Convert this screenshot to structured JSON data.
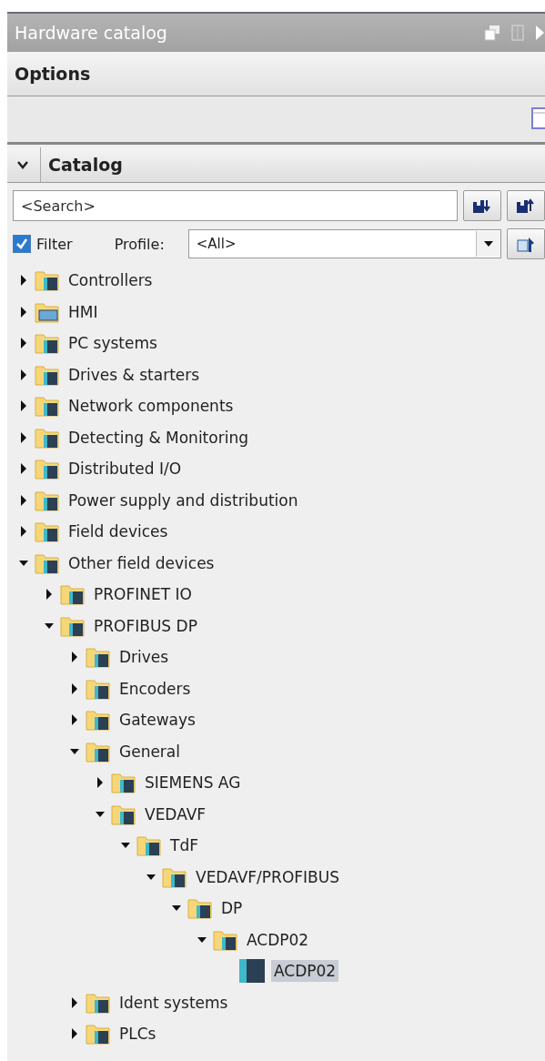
{
  "window": {
    "title": "Hardware catalog"
  },
  "options": {
    "title": "Options"
  },
  "catalog": {
    "title": "Catalog",
    "expanded": true
  },
  "search": {
    "placeholder": "<Search>"
  },
  "filter": {
    "label": "Filter",
    "checked": true
  },
  "profile": {
    "label": "Profile:",
    "value": "<All>"
  },
  "tree": [
    {
      "label": "Controllers",
      "kind": "folder",
      "expanded": false,
      "selected": false
    },
    {
      "label": "HMI",
      "kind": "hmi-folder",
      "expanded": false,
      "selected": false
    },
    {
      "label": "PC systems",
      "kind": "folder",
      "expanded": false,
      "selected": false
    },
    {
      "label": "Drives & starters",
      "kind": "folder",
      "expanded": false,
      "selected": false
    },
    {
      "label": "Network components",
      "kind": "folder",
      "expanded": false,
      "selected": false
    },
    {
      "label": "Detecting & Monitoring",
      "kind": "folder",
      "expanded": false,
      "selected": false
    },
    {
      "label": "Distributed I/O",
      "kind": "folder",
      "expanded": false,
      "selected": false
    },
    {
      "label": "Power supply and distribution",
      "kind": "folder",
      "expanded": false,
      "selected": false
    },
    {
      "label": "Field devices",
      "kind": "folder",
      "expanded": false,
      "selected": false
    },
    {
      "label": "Other field devices",
      "kind": "folder",
      "expanded": true,
      "selected": false,
      "children": [
        {
          "label": "PROFINET IO",
          "kind": "folder",
          "expanded": false,
          "selected": false
        },
        {
          "label": "PROFIBUS DP",
          "kind": "folder",
          "expanded": true,
          "selected": false,
          "children": [
            {
              "label": "Drives",
              "kind": "folder",
              "expanded": false,
              "selected": false
            },
            {
              "label": "Encoders",
              "kind": "folder",
              "expanded": false,
              "selected": false
            },
            {
              "label": "Gateways",
              "kind": "folder",
              "expanded": false,
              "selected": false
            },
            {
              "label": "General",
              "kind": "folder",
              "expanded": true,
              "selected": false,
              "children": [
                {
                  "label": "SIEMENS AG",
                  "kind": "folder",
                  "expanded": false,
                  "selected": false
                },
                {
                  "label": "VEDAVF",
                  "kind": "folder",
                  "expanded": true,
                  "selected": false,
                  "children": [
                    {
                      "label": "TdF",
                      "kind": "folder",
                      "expanded": true,
                      "selected": false,
                      "children": [
                        {
                          "label": "VEDAVF/PROFIBUS",
                          "kind": "folder",
                          "expanded": true,
                          "selected": false,
                          "children": [
                            {
                              "label": "DP",
                              "kind": "folder",
                              "expanded": true,
                              "selected": false,
                              "children": [
                                {
                                  "label": "ACDP02",
                                  "kind": "folder",
                                  "expanded": true,
                                  "selected": false,
                                  "children": [
                                    {
                                      "label": "ACDP02",
                                      "kind": "device",
                                      "selected": true
                                    }
                                  ]
                                }
                              ]
                            }
                          ]
                        }
                      ]
                    }
                  ]
                }
              ]
            },
            {
              "label": "Ident systems",
              "kind": "folder",
              "expanded": false,
              "selected": false
            },
            {
              "label": "PLCs",
              "kind": "folder",
              "expanded": false,
              "selected": false
            }
          ]
        }
      ]
    }
  ]
}
